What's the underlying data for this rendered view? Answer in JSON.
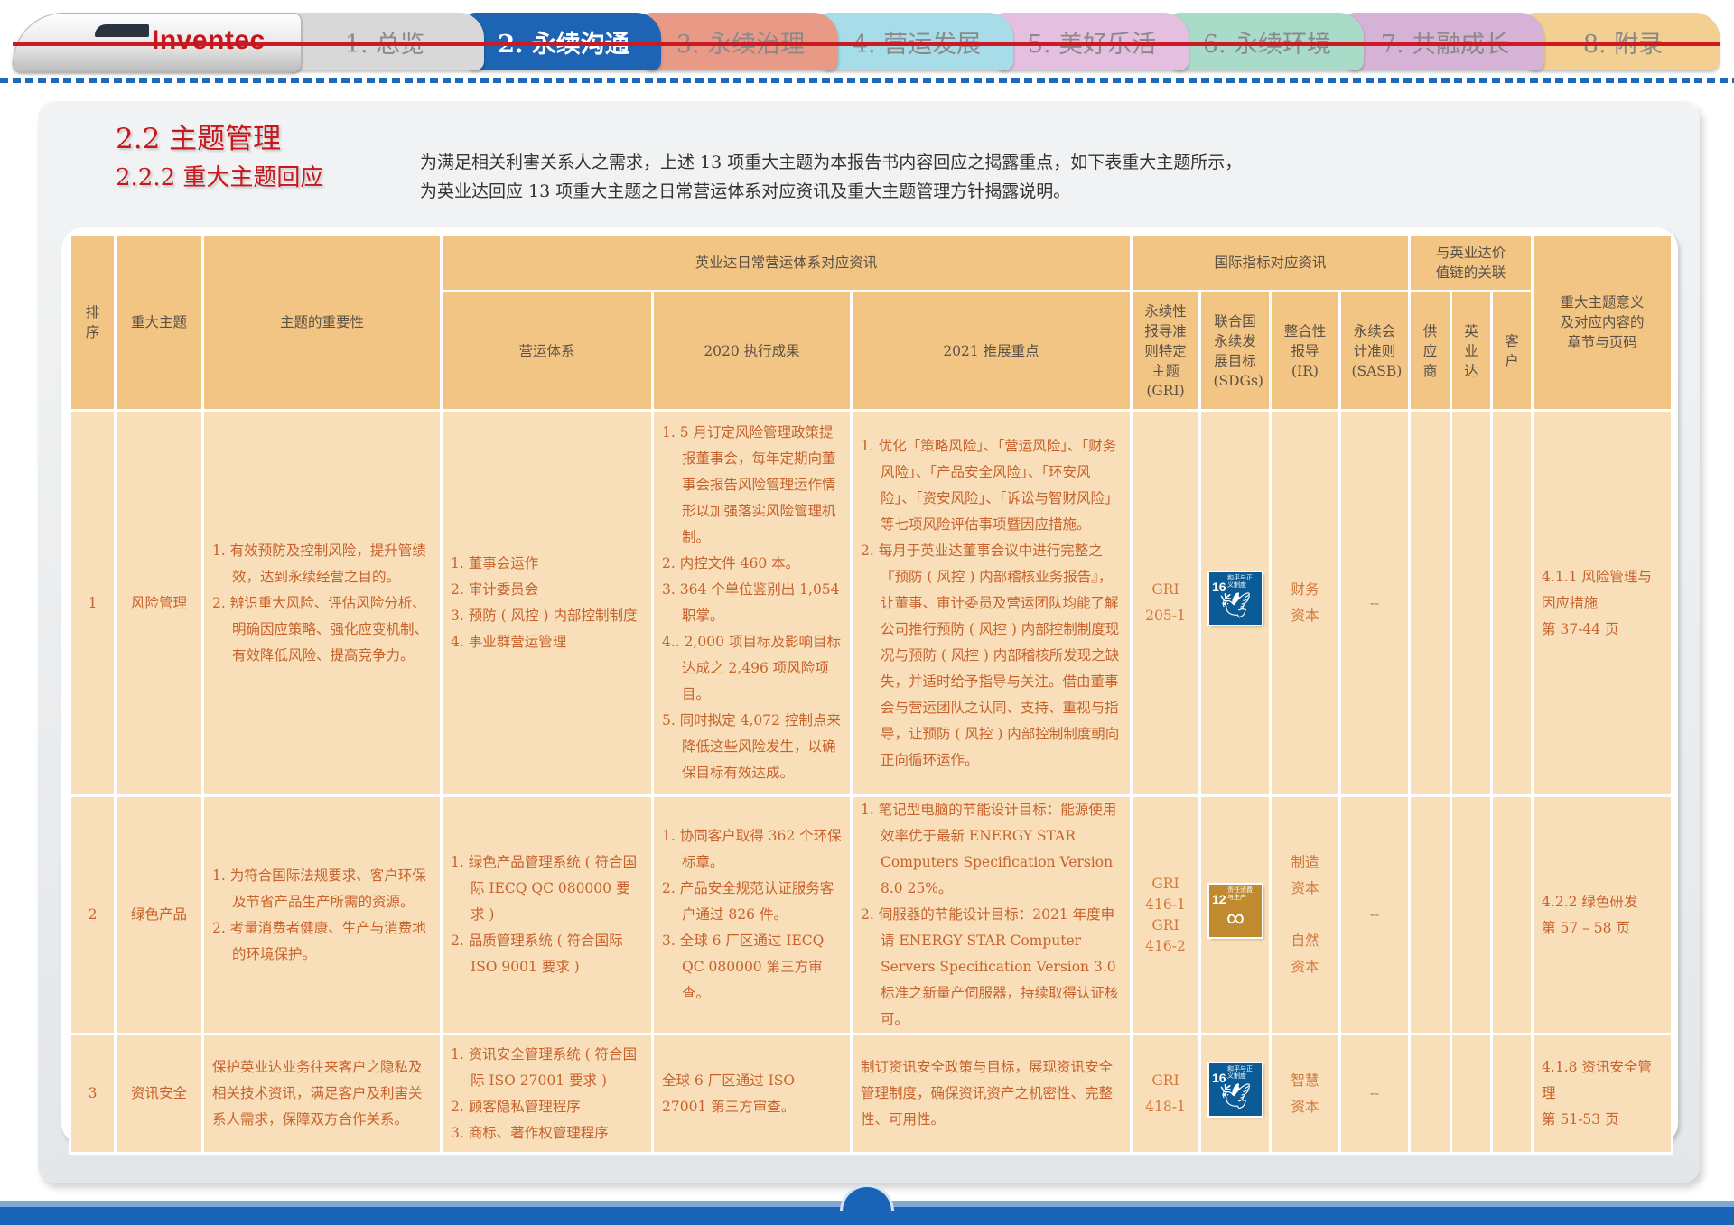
{
  "brand": {
    "logo_text": "Inventec"
  },
  "nav": {
    "tabs": [
      {
        "label": "1. 总览",
        "color": "#d8d8d8",
        "active": false
      },
      {
        "label": "2. 永续沟通",
        "color": "#1d64b5",
        "active": true
      },
      {
        "label": "3. 永续治理",
        "color": "#e99a86",
        "active": false
      },
      {
        "label": "4. 营运发展",
        "color": "#a7dde8",
        "active": false
      },
      {
        "label": "5. 美好乐活",
        "color": "#e4bfe0",
        "active": false
      },
      {
        "label": "6. 永续环境",
        "color": "#a9dbc9",
        "active": false
      },
      {
        "label": "7. 共融成长",
        "color": "#d6b2d6",
        "active": false
      },
      {
        "label": "8. 附录",
        "color": "#f3cf92",
        "active": false
      }
    ]
  },
  "section": {
    "title": "2.2  主题管理",
    "subtitle": "2.2.2  重大主题回应",
    "intro_line1": "为满足相关利害关系人之需求，上述 13 项重大主题为本报告书内容回应之揭露重点，如下表重大主题所示，",
    "intro_line2": "为英业达回应 13 项重大主题之日常营运体系对应资讯及重大主题管理方针揭露说明。"
  },
  "table": {
    "headers": {
      "rank": "排序",
      "topic": "重大主题",
      "importance": "主题的重要性",
      "ops_group": "英业达日常营运体系对应资讯",
      "ops_system": "营运体系",
      "result_2020": "2020 执行成果",
      "focus_2021": "2021 推展重点",
      "intl_group": "国际指标对应资讯",
      "gri": "永续性报导准则特定主题(GRI)",
      "sdgs": "联合国永续发展目标(SDGs)",
      "ir": "整合性报导(IR)",
      "sasb": "永续会计准则(SASB)",
      "chain_group": "与英业达价值链的关联",
      "supplier": "供应商",
      "inventec": "英业达",
      "customer": "客户",
      "chapter": "重大主题意义及对应内容的章节与页码"
    },
    "rows": [
      {
        "rank": "1",
        "topic": "风险管理",
        "importance": [
          "1. 有效预防及控制风险，提升管绩效，达到永续经营之目的。",
          "2. 辨识重大风险、评估风险分析、明确因应策略、强化应变机制、有效降低风险、提高竞争力。"
        ],
        "ops_system": [
          "1. 董事会运作",
          "2. 审计委员会",
          "3. 预防 ( 风控 ) 内部控制制度",
          "4. 事业群营运管理"
        ],
        "result_2020": [
          "1.  5 月订定风险管理政策提报董事会，每年定期向董事会报告风险管理运作情形以加强落实风险管理机制。",
          "2. 内控文件 460 本。",
          "3. 364 个单位鉴别出 1,054 职掌。",
          "4.. 2,000 项目标及影响目标达成之 2,496 项风险项目。",
          "5. 同时拟定 4,072 控制点来降低这些风险发生，以确保目标有效达成。"
        ],
        "focus_2021": [
          "1. 优化「策略风险」、「营运风险」、「财务风险」、「产品安全风险」、「环安风险」、「资安风险」、「诉讼与智财风险」等七项风险评估事项暨因应措施。",
          "2. 每月于英业达董事会议中进行完整之『预防 ( 风控 ) 内部稽核业务报告』，让董事、审计委员及营运团队均能了解公司推行预防 ( 风控 ) 内部控制制度现况与预防 ( 风控 ) 内部稽核所发现之缺失，并适时给予指导与关注。借由董事会与营运团队之认同、支持、重视与指导，让预防 ( 风控 ) 内部控制制度朝向正向循环运作。"
        ],
        "gri": [
          "GRI",
          "205-1"
        ],
        "sdg": {
          "number": "16",
          "text": "和平与正义制度",
          "color": "#0b5c96",
          "icon": "dove-icon",
          "glyph": "🕊"
        },
        "ir": [
          "财务",
          "资本"
        ],
        "sasb": "--",
        "chapter": [
          "4.1.1  风险管理与因应措施",
          "第 37-44 页"
        ]
      },
      {
        "rank": "2",
        "topic": "绿色产品",
        "importance": [
          "1. 为符合国际法规要求、客户环保及节省产品生产所需的资源。",
          "2. 考量消费者健康、生产与消费地的环境保护。"
        ],
        "ops_system": [
          "1.  绿色产品管理系统 ( 符合国际 IECQ QC 080000 要求 )",
          "2.  品质管理系统 ( 符合国际 ISO 9001 要求 )"
        ],
        "result_2020": [
          "1. 协同客户取得 362 个环保标章。",
          "2. 产品安全规范认证服务客户通过 826 件。",
          "3. 全球 6 厂区通过 IECQ QC 080000 第三方审查。"
        ],
        "focus_2021": [
          "1.  笔记型电脑的节能设计目标：能源使用效率优于最新 ENERGY STAR Computers Specification Version 8.0 25%。",
          "2.  伺服器的节能设计目标：2021 年度申请 ENERGY STAR Computer Servers Specification Version 3.0 标准之新量产伺服器，持续取得认证核可。"
        ],
        "gri": [
          "GRI",
          "416-1",
          "GRI",
          "416-2"
        ],
        "sdg": {
          "number": "12",
          "text": "责任消费与生产",
          "color": "#bf8b2e",
          "icon": "infinity-icon",
          "glyph": "∞"
        },
        "ir": [
          "制造",
          "资本",
          "",
          "自然",
          "资本"
        ],
        "sasb": "--",
        "chapter": [
          "4.2.2  绿色研发",
          "第 57 – 58 页"
        ]
      },
      {
        "rank": "3",
        "topic": "资讯安全",
        "importance": [
          "保护英业达业务往来客户之隐私及相关技术资讯，满足客户及利害关系人需求，保障双方合作关系。"
        ],
        "ops_system": [
          "1. 资讯安全管理系统  ( 符合国际 ISO 27001 要求 )",
          "2. 顾客隐私管理程序",
          "3. 商标、著作权管理程序"
        ],
        "result_2020": [
          "全球 6 厂区通过 ISO 27001 第三方审查。"
        ],
        "focus_2021": [
          "制订资讯安全政策与目标，展现资讯安全管理制度，确保资讯资产之机密性、完整性、可用性。"
        ],
        "gri": [
          "GRI",
          "418-1"
        ],
        "sdg": {
          "number": "16",
          "text": "和平与正义制度",
          "color": "#0b5c96",
          "icon": "dove-icon",
          "glyph": "🕊"
        },
        "ir": [
          "智慧",
          "资本"
        ],
        "sasb": "--",
        "chapter": [
          "4.1.8  资讯安全管理",
          "第 51-53 页"
        ]
      }
    ]
  }
}
